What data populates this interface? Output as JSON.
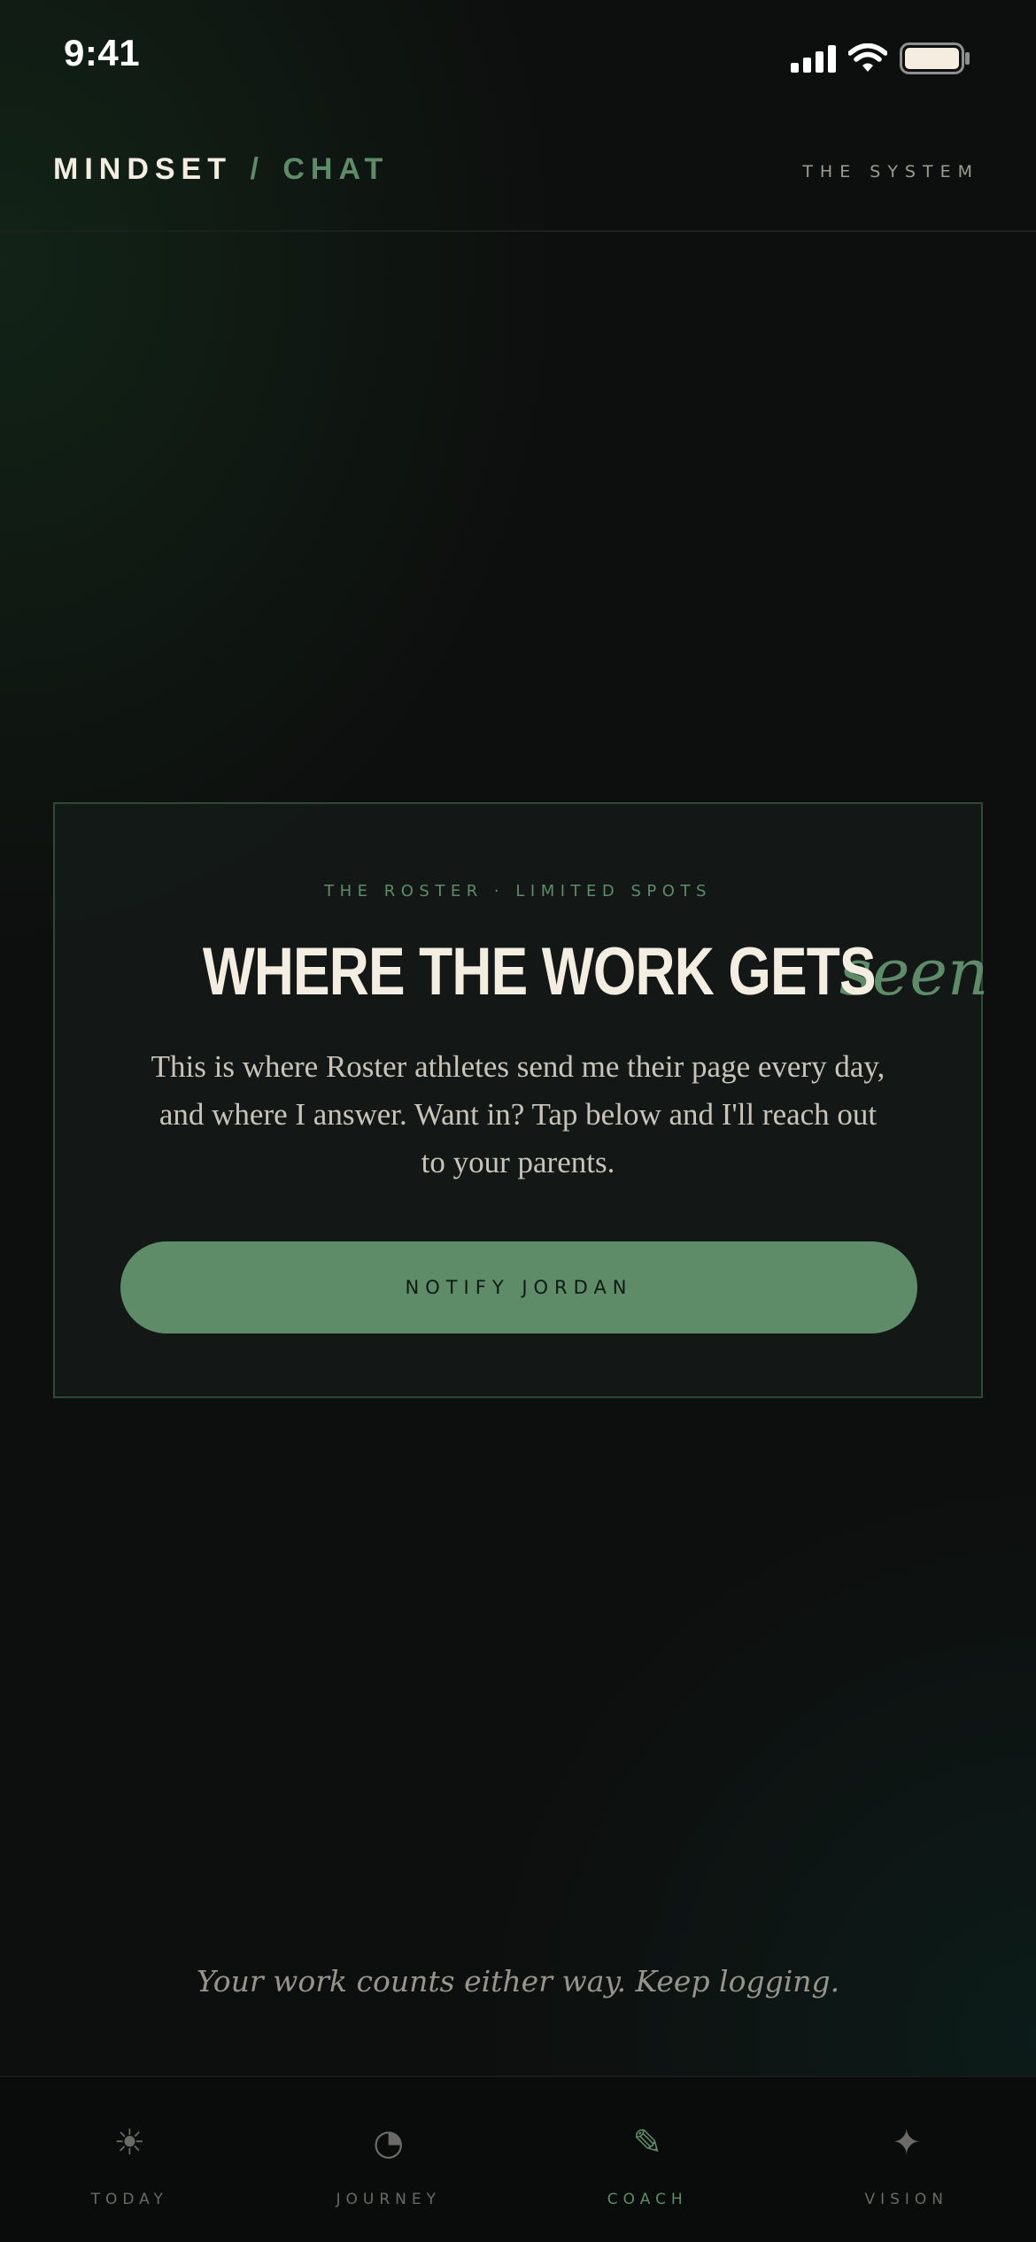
{
  "status_bar": {
    "time": "9:41"
  },
  "header": {
    "brand_main": "MINDSET",
    "brand_slash": "/",
    "brand_sub": "CHAT",
    "right_link": "THE SYSTEM"
  },
  "card": {
    "eyebrow": "THE ROSTER · LIMITED SPOTS",
    "title_main": "WHERE THE WORK GETS",
    "title_accent": "seen",
    "body_lines": [
      "This is where Roster athletes send me their page every day,",
      "and where I answer. Want in? Tap below and I'll reach out",
      "to your parents."
    ],
    "button_label": "NOTIFY JORDAN"
  },
  "footer_note": "Your work counts either way. Keep logging.",
  "nav": {
    "items": [
      {
        "label": "TODAY",
        "icon": "sun-icon",
        "glyph": "☀",
        "active": false
      },
      {
        "label": "JOURNEY",
        "icon": "pie-chart-icon",
        "glyph": "◔",
        "active": false
      },
      {
        "label": "COACH",
        "icon": "pencil-icon",
        "glyph": "✎",
        "active": true
      },
      {
        "label": "VISION",
        "icon": "sparkle-icon",
        "glyph": "✦",
        "active": false
      }
    ]
  },
  "colors": {
    "background": "#0d0f0e",
    "accent_green": "#5e8c68",
    "text_primary": "#f3ede2",
    "text_muted": "#97948c"
  }
}
